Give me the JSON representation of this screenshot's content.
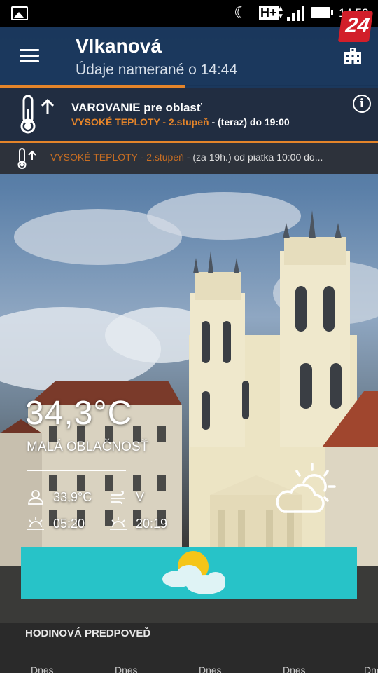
{
  "status_bar": {
    "time": "14:53",
    "network": "H+",
    "icons": [
      "gallery-icon",
      "moon-icon",
      "signal-icon",
      "battery-icon"
    ]
  },
  "brand_logo": "24",
  "header": {
    "city": "Vlkanová",
    "measured": "Údaje namerané o 14:44"
  },
  "progress_fraction": 0.49,
  "warning": {
    "title": "VAROVANIE pre oblasť",
    "level_text": "VYSOKÉ TEPLOTY - 2.stupeň",
    "time_text": " - (teraz) do 19:00",
    "info_label": "i"
  },
  "warning_next": {
    "level_text": "VYSOKÉ TEPLOTY - 2.stupeň",
    "time_text": " - (za 19h.) od piatka 10:00 do..."
  },
  "current": {
    "temperature": "34,3°C",
    "condition": "MALÁ OBLAČNOSŤ",
    "feels_like": "33,9°C",
    "wind": "V",
    "sunrise": "05:20",
    "sunset": "20:19"
  },
  "hourly": {
    "title": "HODINOVÁ PREDPOVEĎ",
    "labels": [
      "Dnes",
      "Dnes",
      "Dnes",
      "Dnes",
      "Dnes"
    ]
  },
  "colors": {
    "accent": "#e4842a",
    "header_bg": "#183458",
    "banner_bg": "#27c3c8",
    "brand_red": "#d21f2a"
  }
}
